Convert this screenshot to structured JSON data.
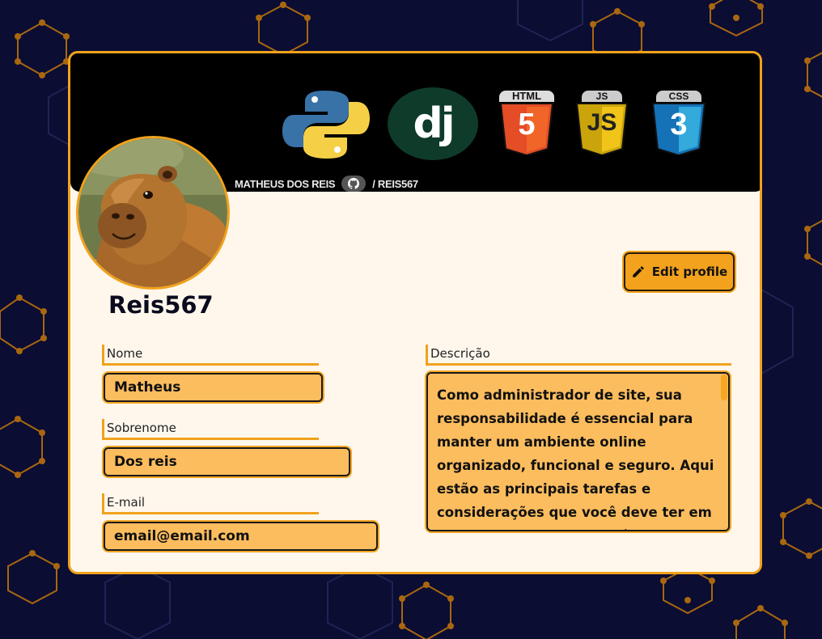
{
  "banner": {
    "credit_name": "MATHEUS DOS REIS",
    "credit_handle": "/ REIS567",
    "logos": {
      "python": "python-logo",
      "django": "dj",
      "html": "HTML",
      "html_number": "5",
      "js": "JS",
      "css": "CSS",
      "css_number": "3"
    }
  },
  "profile": {
    "username": "Reis567",
    "avatar": "capybara-photo",
    "edit_button_label": "Edit profile"
  },
  "fields": {
    "nome": {
      "label": "Nome",
      "value": "Matheus"
    },
    "sobrenome": {
      "label": "Sobrenome",
      "value": "Dos reis"
    },
    "email": {
      "label": "E-mail",
      "value": "email@email.com"
    },
    "descricao": {
      "label": "Descrição",
      "value": "Como administrador de site, sua responsabilidade é essencial para manter um ambiente online organizado, funcional e seguro. Aqui estão as principais tarefas e considerações que você deve ter em mente. Controle o conteúdo"
    }
  },
  "colors": {
    "background": "#0b0d33",
    "accent": "#f0a21c",
    "card": "#fff7ec",
    "input": "#fcbd5e"
  }
}
